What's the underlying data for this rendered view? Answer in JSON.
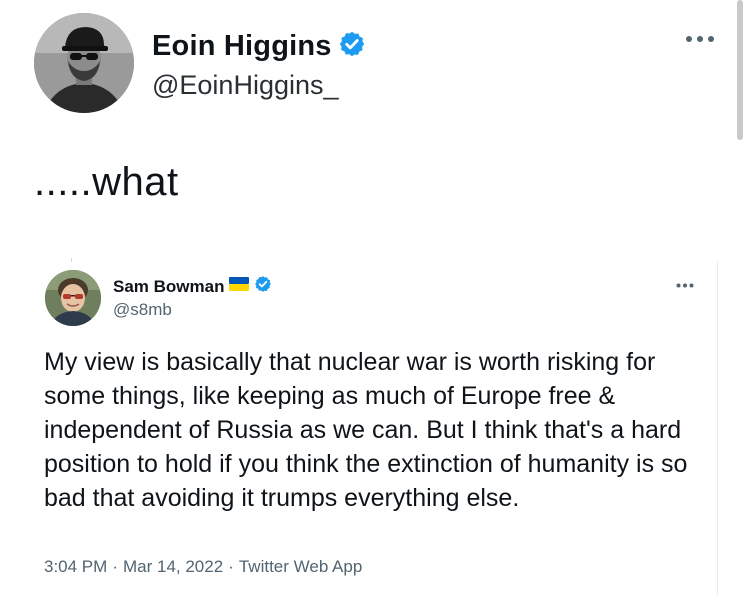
{
  "outer_tweet": {
    "name": "Eoin Higgins",
    "handle": "@EoinHiggins_",
    "text": ".....what",
    "verified": true,
    "more_icon": "more-horizontal-icon"
  },
  "quoted_tweet": {
    "name": "Sam Bowman",
    "handle": "@s8mb",
    "flag_icon": "ukraine-flag-icon",
    "verified": true,
    "text": "My view is basically that nuclear war is worth risking for some things, like keeping as much of Europe free & independent of Russia as we can. But I think that's a hard position to hold if you think the extinction of humanity is so bad that avoiding it trumps everything else.",
    "time": "3:04 PM",
    "date": "Mar 14, 2022",
    "source": "Twitter Web App",
    "separator": "·"
  },
  "colors": {
    "verified_blue": "#1d9bf0",
    "flag_blue": "#0057b7",
    "flag_yellow": "#ffd700",
    "secondary_text": "#536471"
  }
}
